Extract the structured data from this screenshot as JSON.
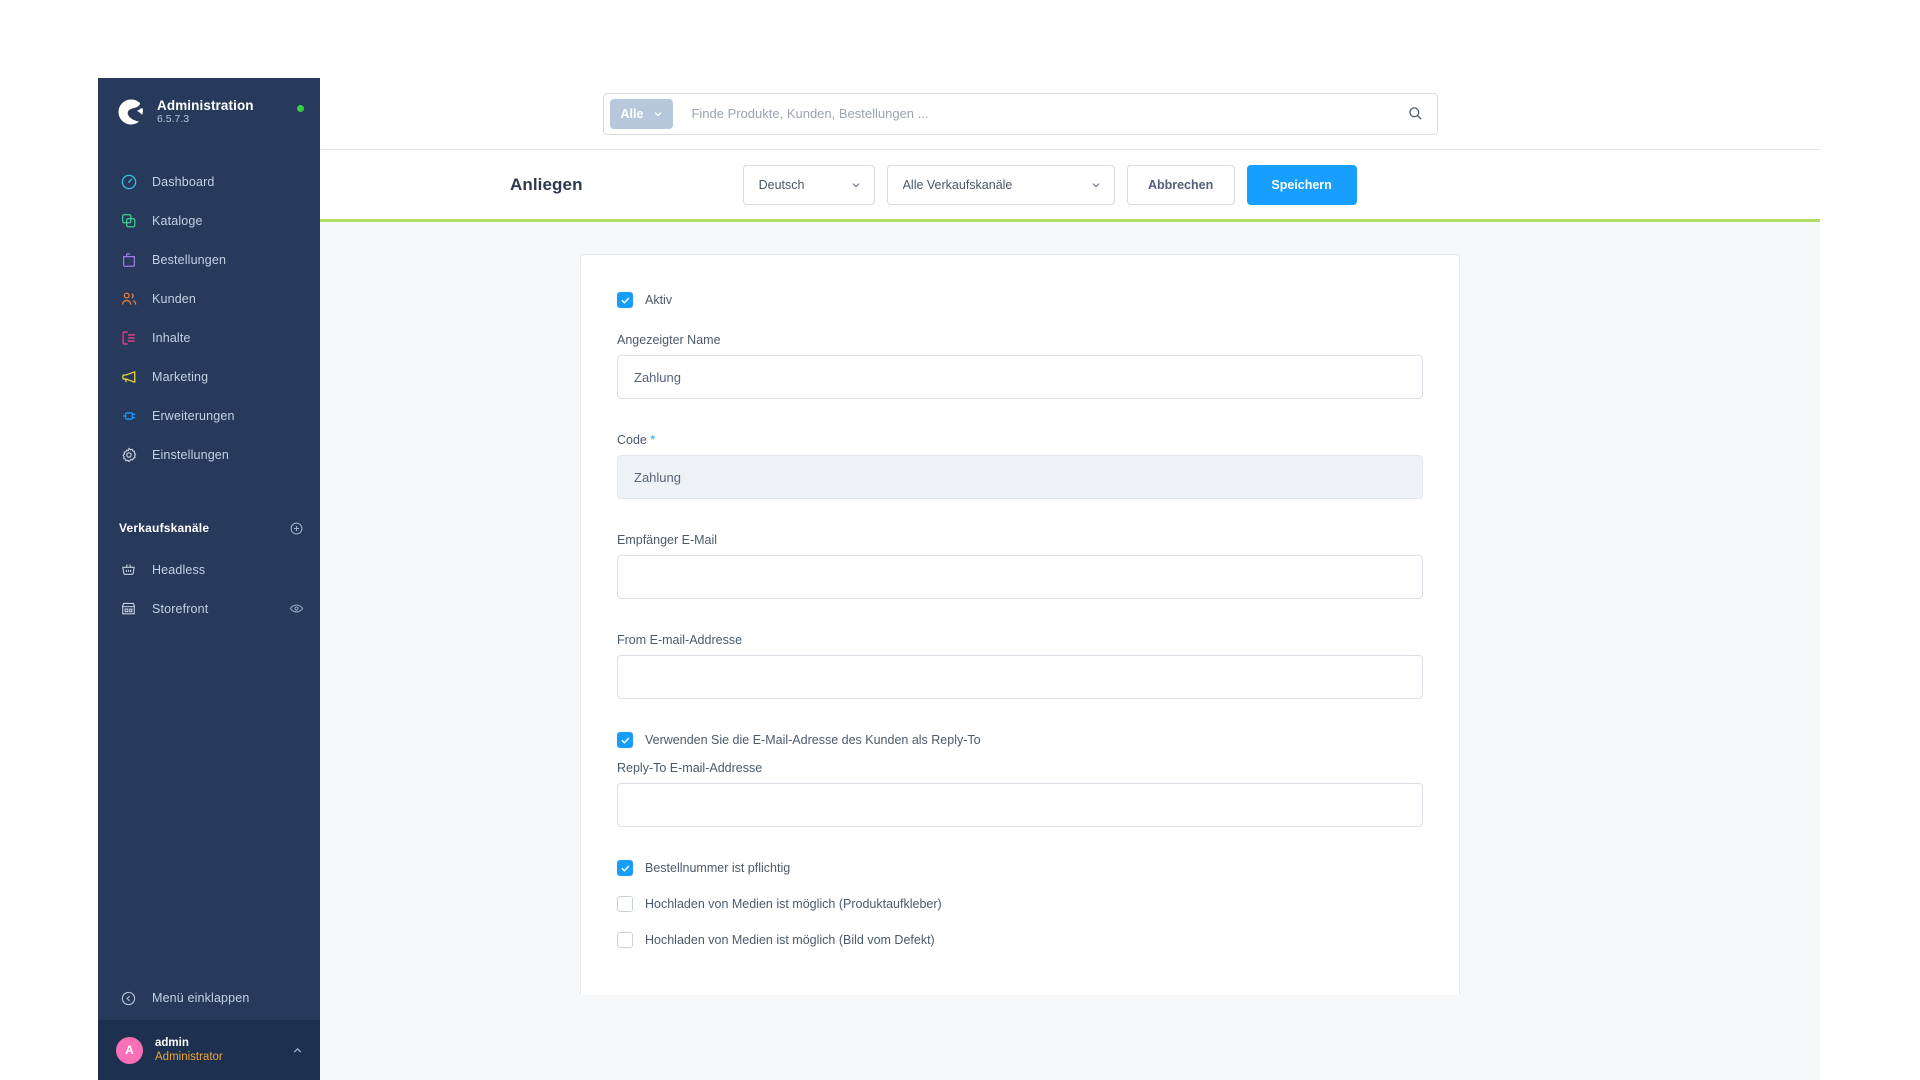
{
  "sidebar": {
    "brand": {
      "title": "Administration",
      "version": "6.5.7.3",
      "status": "online"
    },
    "items": [
      {
        "label": "Dashboard",
        "icon": "dashboard-icon",
        "color": "#37c2dd"
      },
      {
        "label": "Kataloge",
        "icon": "catalog-icon",
        "color": "#3ecf8e"
      },
      {
        "label": "Bestellungen",
        "icon": "orders-icon",
        "color": "#9d7ae8"
      },
      {
        "label": "Kunden",
        "icon": "customers-icon",
        "color": "#e8803a"
      },
      {
        "label": "Inhalte",
        "icon": "content-icon",
        "color": "#ee3a8c"
      },
      {
        "label": "Marketing",
        "icon": "marketing-icon",
        "color": "#f0d93a"
      },
      {
        "label": "Erweiterungen",
        "icon": "extensions-icon",
        "color": "#189eff"
      },
      {
        "label": "Einstellungen",
        "icon": "settings-icon",
        "color": "#c5cfdb"
      }
    ],
    "section_title": "Verkaufskanäle",
    "channels": [
      {
        "label": "Headless",
        "icon": "basket-icon"
      },
      {
        "label": "Storefront",
        "icon": "store-icon",
        "trailing_icon": "eye-icon"
      }
    ],
    "collapse_label": "Menü einklappen",
    "user": {
      "initial": "A",
      "name": "admin",
      "role": "Administrator"
    }
  },
  "topbar": {
    "scope_label": "Alle",
    "search_placeholder": "Finde Produkte, Kunden, Bestellungen ...",
    "search_value": "",
    "search_icon": "search-icon"
  },
  "smartbar": {
    "title": "Anliegen",
    "language": "Deutsch",
    "sales_channel": "Alle Verkaufskanäle",
    "cancel_label": "Abbrechen",
    "save_label": "Speichern"
  },
  "form": {
    "active": {
      "label": "Aktiv",
      "checked": true
    },
    "display_name": {
      "label": "Angezeigter Name",
      "value": "Zahlung",
      "placeholder": ""
    },
    "code": {
      "label": "Code",
      "required_marker": "*",
      "value": "Zahlung",
      "readonly": true
    },
    "recipient_email": {
      "label": "Empfänger E-Mail",
      "value": "",
      "placeholder": ""
    },
    "from_email": {
      "label": "From E-mail-Addresse",
      "value": "",
      "placeholder": ""
    },
    "use_customer_reply_to": {
      "label": "Verwenden Sie die E-Mail-Adresse des Kunden als Reply-To",
      "checked": true
    },
    "reply_to_email": {
      "label": "Reply-To E-mail-Addresse",
      "value": "",
      "placeholder": ""
    },
    "order_number_required": {
      "label": "Bestellnummer ist pflichtig",
      "checked": true
    },
    "upload_product_sticker": {
      "label": "Hochladen von Medien ist möglich (Produktaufkleber)",
      "checked": false
    },
    "upload_defect_image": {
      "label": "Hochladen von Medien ist möglich (Bild vom Defekt)",
      "checked": false
    }
  },
  "colors": {
    "sidebar_bg": "#273a5c",
    "accent_blue": "#189eff",
    "smartbar_underline": "#b0dd64",
    "status_dot": "#37d046",
    "avatar": "#fa70b6",
    "role_text": "#f0a33a"
  }
}
